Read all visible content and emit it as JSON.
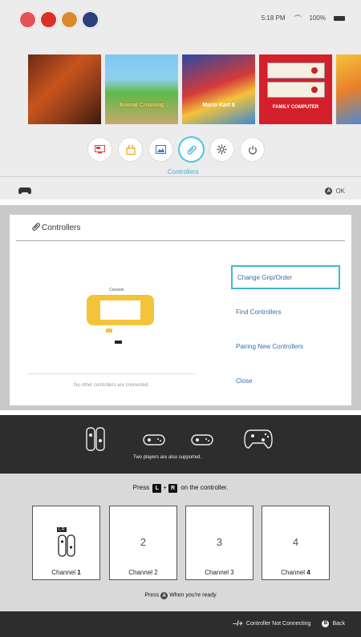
{
  "home": {
    "time": "5:18 PM",
    "battery": "100%",
    "games": [
      {
        "label": ""
      },
      {
        "label": "Animal Crossing"
      },
      {
        "label": "Mario Kart 8"
      },
      {
        "label": "FAMILY COMPUTER"
      },
      {
        "label": ""
      }
    ],
    "nav_caption": "Controllers",
    "ok_button": "A",
    "ok_label": "OK"
  },
  "controllers": {
    "title": "Controllers",
    "console_label": "Console",
    "no_other": "No other controllers are connected.",
    "menu": [
      {
        "label": "Change Grip/Order"
      },
      {
        "label": "Find Controllers"
      },
      {
        "label": "Pairing New Controllers"
      },
      {
        "label": "Close"
      }
    ]
  },
  "pairing": {
    "two_players": "Two players are also supported.",
    "press_prefix": "Press",
    "key_l": "L",
    "plus": "+",
    "key_r": "R",
    "press_suffix": "on the controller.",
    "lr_mark": "L R",
    "channels": [
      {
        "num": "",
        "label": "Channel",
        "n": "1"
      },
      {
        "num": "2",
        "label": "Channel",
        "n": "2"
      },
      {
        "num": "3",
        "label": "Channel",
        "n": "3"
      },
      {
        "num": "4",
        "label": "Channel",
        "n": "4"
      }
    ],
    "ready_prefix": "Press",
    "ready_key": "A",
    "ready_suffix": "When you're ready",
    "bottom_minus_plus": "–/+",
    "bottom_text": "Controller Not Connecting",
    "back_key": "B",
    "back_label": "Back"
  },
  "colors": {
    "accent_teal": "#3fb8d4",
    "lite_yellow": "#f3c33a",
    "link_blue": "#3a6ea5"
  }
}
